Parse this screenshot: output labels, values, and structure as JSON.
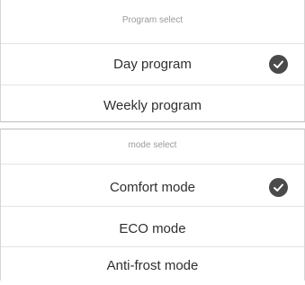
{
  "program_select": {
    "header": "Program select",
    "options": [
      {
        "label": "Day program",
        "selected": true
      },
      {
        "label": "Weekly program",
        "selected": false
      }
    ]
  },
  "mode_select": {
    "header": "mode select",
    "options": [
      {
        "label": "Comfort mode",
        "selected": true
      },
      {
        "label": "ECO mode",
        "selected": false
      },
      {
        "label": "Anti-frost mode",
        "selected": false
      }
    ]
  },
  "icons": {
    "selected_indicator": "check-circle-icon"
  },
  "colors": {
    "check_background": "#4a4a4a",
    "header_text": "#9a9a9a",
    "option_text": "#2f2f2f"
  }
}
